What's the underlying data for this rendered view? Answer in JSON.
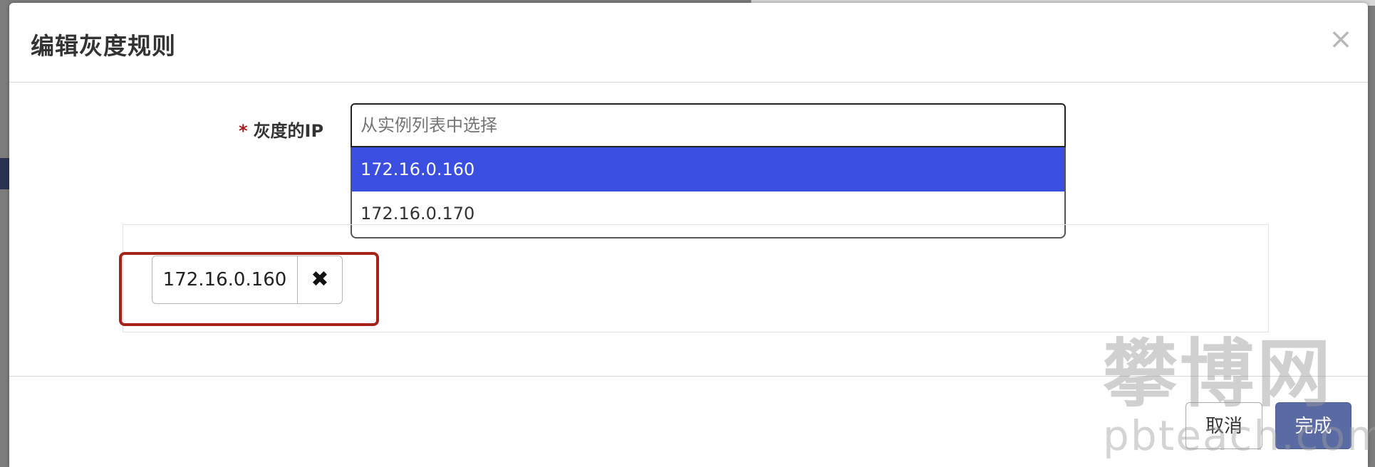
{
  "modal": {
    "title": "编辑灰度规则",
    "close_label": "×"
  },
  "form": {
    "required_mark": "*",
    "ip_label": "灰度的IP",
    "select_placeholder": "从实例列表中选择",
    "options": [
      {
        "label": "172.16.0.160",
        "highlighted": true
      },
      {
        "label": "172.16.0.170",
        "highlighted": false
      }
    ]
  },
  "selected_tags": [
    {
      "label": "172.16.0.160",
      "remove_label": "✖"
    }
  ],
  "footer": {
    "cancel_label": "取消",
    "done_label": "完成"
  },
  "watermark": {
    "cn": "攀博网",
    "en": "pbteach.com"
  },
  "colors": {
    "option_highlight": "#3a4fe0",
    "primary_button": "#5a6aa3",
    "annotation_box": "#a3231b",
    "required_mark": "#a21c1c"
  }
}
